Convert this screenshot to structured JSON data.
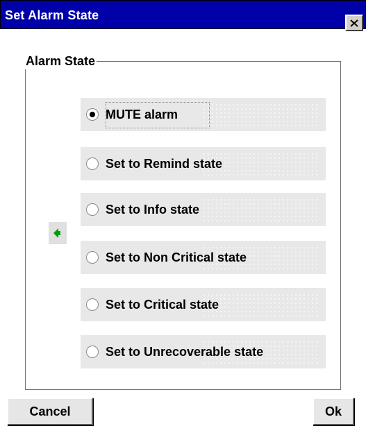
{
  "window": {
    "title": "Set Alarm State",
    "colors": {
      "titlebar": "#0000a8",
      "option_background": "#e8e8e8",
      "speaker_icon": "#00a000"
    }
  },
  "group": {
    "label": "Alarm State",
    "options": [
      {
        "label": "MUTE alarm",
        "selected": true
      },
      {
        "label": "Set to Remind state",
        "selected": false
      },
      {
        "label": "Set to Info state",
        "selected": false
      },
      {
        "label": "Set to Non Critical state",
        "selected": false
      },
      {
        "label": "Set to Critical state",
        "selected": false
      },
      {
        "label": "Set to Unrecoverable state",
        "selected": false
      }
    ],
    "status_icon": "speaker-icon"
  },
  "buttons": {
    "cancel_label": "Cancel",
    "ok_label": "Ok"
  }
}
